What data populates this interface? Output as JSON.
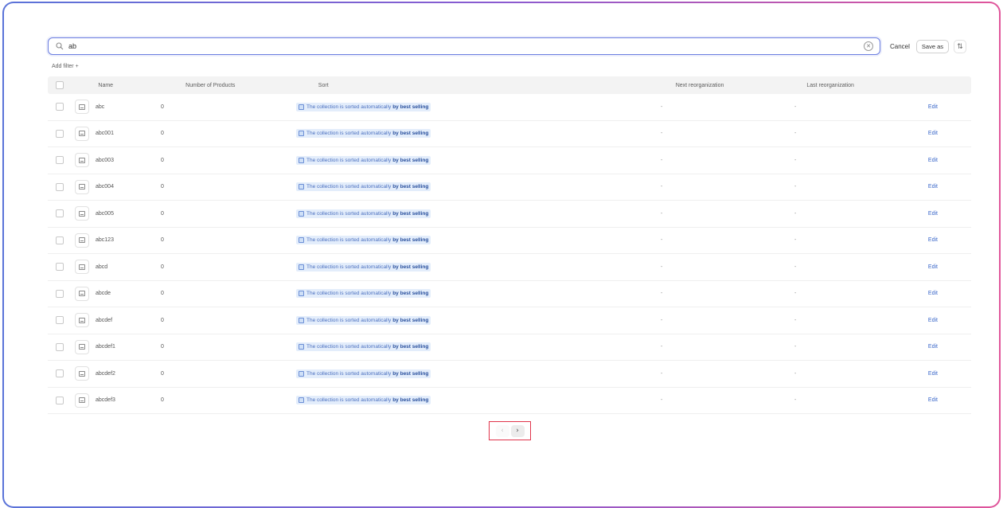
{
  "search": {
    "value": "ab",
    "placeholder": ""
  },
  "toolbar": {
    "cancel_label": "Cancel",
    "save_as_label": "Save as",
    "sort_icon": "sort-arrows-icon"
  },
  "filter": {
    "add_filter_label": "Add filter +"
  },
  "table": {
    "headers": {
      "name": "Name",
      "products": "Number of Products",
      "sort": "Sort",
      "next": "Next reorganization",
      "last": "Last reorganization"
    },
    "sort_text": "The collection is sorted automatically",
    "sort_bold": "by best selling",
    "edit_label": "Edit",
    "rows": [
      {
        "name": "abc",
        "products": "0",
        "next": "-",
        "last": "-"
      },
      {
        "name": "abc001",
        "products": "0",
        "next": "-",
        "last": "-"
      },
      {
        "name": "abc003",
        "products": "0",
        "next": "-",
        "last": "-"
      },
      {
        "name": "abc004",
        "products": "0",
        "next": "-",
        "last": "-"
      },
      {
        "name": "abc005",
        "products": "0",
        "next": "-",
        "last": "-"
      },
      {
        "name": "abc123",
        "products": "0",
        "next": "-",
        "last": "-"
      },
      {
        "name": "abcd",
        "products": "0",
        "next": "-",
        "last": "-"
      },
      {
        "name": "abcde",
        "products": "0",
        "next": "-",
        "last": "-"
      },
      {
        "name": "abcdef",
        "products": "0",
        "next": "-",
        "last": "-"
      },
      {
        "name": "abcdef1",
        "products": "0",
        "next": "-",
        "last": "-"
      },
      {
        "name": "abcdef2",
        "products": "0",
        "next": "-",
        "last": "-"
      },
      {
        "name": "abcdef3",
        "products": "0",
        "next": "-",
        "last": "-"
      }
    ]
  },
  "pagination": {
    "prev_label": "‹",
    "next_label": "›"
  },
  "colors": {
    "accent": "#3a67c9",
    "highlight": "#e0344b",
    "badge_bg": "#e3edfb"
  }
}
